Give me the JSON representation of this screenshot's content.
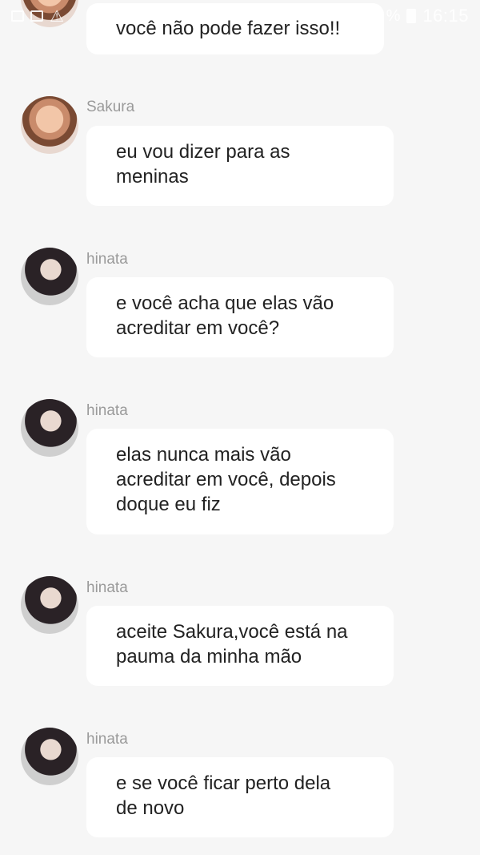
{
  "status_bar": {
    "battery_percent": "%",
    "time": "16:15",
    "icons": [
      "image-icon",
      "folder-icon",
      "warning-icon",
      "battery-icon"
    ]
  },
  "messages": [
    {
      "sender": "",
      "avatar": "sakura-avatar",
      "lines": [
        "você não pode fazer isso!!"
      ]
    },
    {
      "sender": "Sakura",
      "avatar": "sakura-avatar",
      "lines": [
        "eu vou dizer para as",
        "meninas"
      ]
    },
    {
      "sender": "hinata",
      "avatar": "hinata-avatar",
      "lines": [
        "e você acha que elas vão",
        "acreditar em você?"
      ]
    },
    {
      "sender": "hinata",
      "avatar": "hinata-avatar",
      "lines": [
        "elas nunca mais vão",
        "acreditar em você, depois",
        "doque eu fiz"
      ]
    },
    {
      "sender": "hinata",
      "avatar": "hinata-avatar",
      "lines": [
        "aceite Sakura,você está na",
        "pauma da minha mão"
      ]
    },
    {
      "sender": "hinata",
      "avatar": "hinata-avatar",
      "lines": [
        "e se você ficar perto dela",
        "de novo"
      ]
    }
  ]
}
